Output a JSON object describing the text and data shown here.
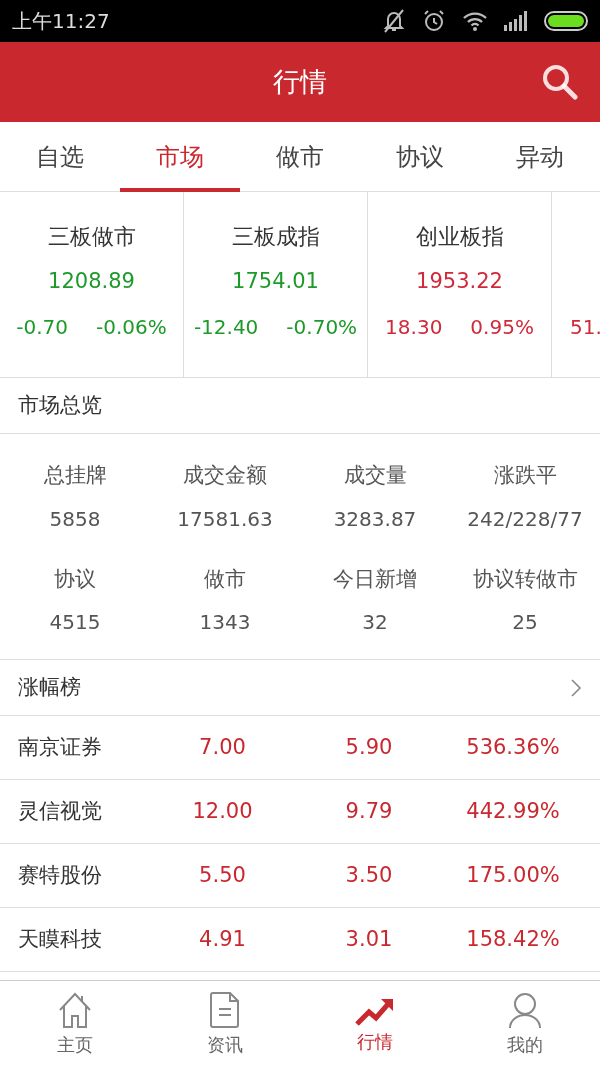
{
  "status_bar": {
    "time": "上午11:27"
  },
  "header": {
    "title": "行情"
  },
  "tabs": [
    {
      "label": "自选",
      "selected": false
    },
    {
      "label": "市场",
      "selected": true
    },
    {
      "label": "做市",
      "selected": false
    },
    {
      "label": "协议",
      "selected": false
    },
    {
      "label": "异动",
      "selected": false
    }
  ],
  "indices": [
    {
      "name": "三板做市",
      "value": "1208.89",
      "change": "-0.70",
      "percent": "-0.06%",
      "kind": "down"
    },
    {
      "name": "三板成指",
      "value": "1754.01",
      "change": "-12.40",
      "percent": "-0.70%",
      "kind": "down"
    },
    {
      "name": "创业板指",
      "value": "1953.22",
      "change": "18.30",
      "percent": "0.95%",
      "kind": "up"
    },
    {
      "change": "51.",
      "kind": "up"
    }
  ],
  "overview": {
    "title": "市场总览",
    "stats": [
      {
        "label": "总挂牌",
        "value": "5858"
      },
      {
        "label": "成交金额",
        "value": "17581.63"
      },
      {
        "label": "成交量",
        "value": "3283.87"
      },
      {
        "label": "涨跌平",
        "value": "242/228/77"
      },
      {
        "label": "协议",
        "value": "4515"
      },
      {
        "label": "做市",
        "value": "1343"
      },
      {
        "label": "今日新增",
        "value": "32"
      },
      {
        "label": "协议转做市",
        "value": "25"
      }
    ]
  },
  "gainers": {
    "title": "涨幅榜",
    "rows": [
      {
        "name": "南京证券",
        "price": "7.00",
        "change": "5.90",
        "percent": "536.36%"
      },
      {
        "name": "灵信视觉",
        "price": "12.00",
        "change": "9.79",
        "percent": "442.99%"
      },
      {
        "name": "赛特股份",
        "price": "5.50",
        "change": "3.50",
        "percent": "175.00%"
      },
      {
        "name": "天瞙科技",
        "price": "4.91",
        "change": "3.01",
        "percent": "158.42%"
      }
    ]
  },
  "bottom_nav": [
    {
      "label": "主页",
      "kind": "home",
      "selected": false
    },
    {
      "label": "资讯",
      "kind": "doc",
      "selected": false
    },
    {
      "label": "行情",
      "kind": "trend",
      "selected": true
    },
    {
      "label": "我的",
      "kind": "user",
      "selected": false
    }
  ]
}
